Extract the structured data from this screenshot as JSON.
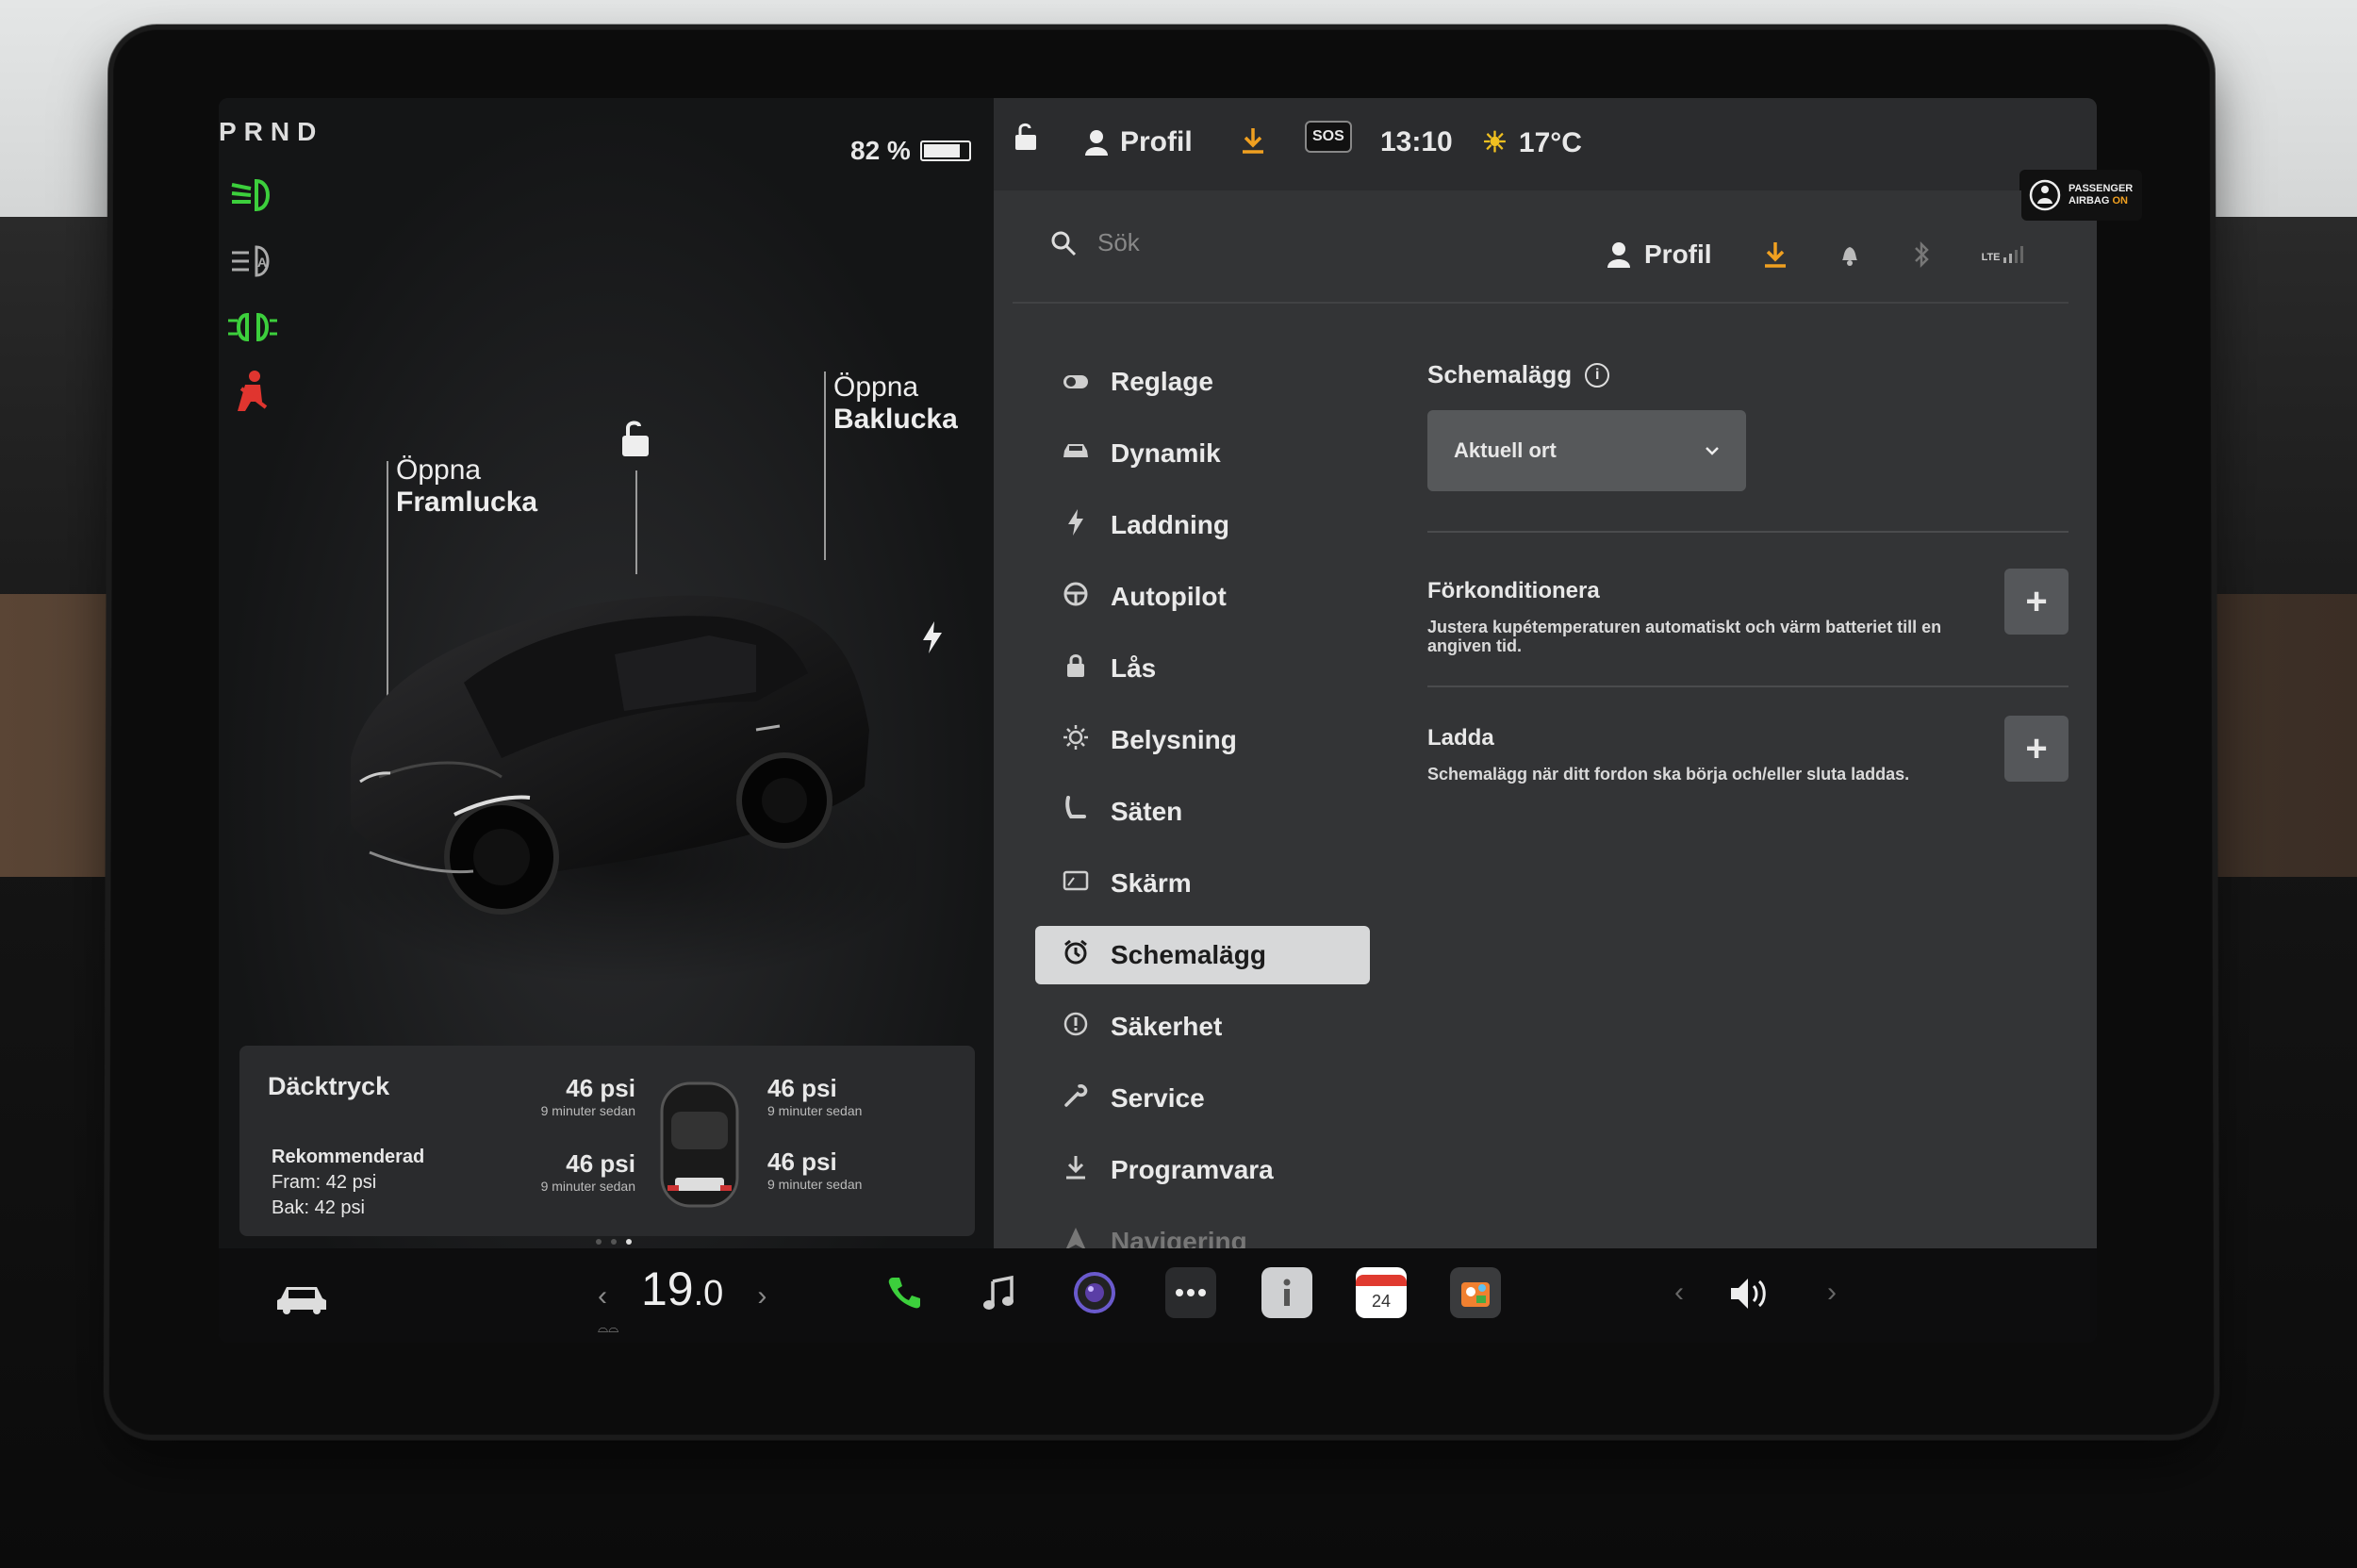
{
  "gear": "PRND",
  "battery": {
    "percent_label": "82 %",
    "level": 0.82
  },
  "vehicle": {
    "frunk": {
      "line1": "Öppna",
      "line2": "Framlucka"
    },
    "trunk": {
      "line1": "Öppna",
      "line2": "Baklucka"
    }
  },
  "tires": {
    "title": "Däcktryck",
    "recommended_label": "Rekommenderad",
    "front": "Fram: 42 psi",
    "rear": "Bak: 42 psi",
    "front_left": {
      "value": "46 psi",
      "age": "9 minuter sedan"
    },
    "front_right": {
      "value": "46 psi",
      "age": "9 minuter sedan"
    },
    "rear_left": {
      "value": "46 psi",
      "age": "9 minuter sedan"
    },
    "rear_right": {
      "value": "46 psi",
      "age": "9 minuter sedan"
    }
  },
  "statusbar": {
    "profile": "Profil",
    "sos": "SOS",
    "time": "13:10",
    "temperature": "17°C",
    "airbag_line1": "PASSENGER",
    "airbag_line2_prefix": "AIRBAG",
    "airbag_line2_state": "ON"
  },
  "settings": {
    "search_placeholder": "Sök",
    "profile": "Profil",
    "lte": "LTE",
    "menu": [
      {
        "label": "Reglage",
        "icon": "toggle-icon"
      },
      {
        "label": "Dynamik",
        "icon": "car-icon"
      },
      {
        "label": "Laddning",
        "icon": "bolt-icon"
      },
      {
        "label": "Autopilot",
        "icon": "steering-wheel-icon"
      },
      {
        "label": "Lås",
        "icon": "lock-icon"
      },
      {
        "label": "Belysning",
        "icon": "sun-icon"
      },
      {
        "label": "Säten",
        "icon": "seat-icon"
      },
      {
        "label": "Skärm",
        "icon": "display-icon"
      },
      {
        "label": "Schemalägg",
        "icon": "alarm-clock-icon",
        "active": true
      },
      {
        "label": "Säkerhet",
        "icon": "alert-icon"
      },
      {
        "label": "Service",
        "icon": "wrench-icon"
      },
      {
        "label": "Programvara",
        "icon": "download-icon"
      },
      {
        "label": "Navigering",
        "icon": "navigation-icon"
      }
    ],
    "schedule": {
      "title": "Schemalägg",
      "location_value": "Aktuell ort",
      "precondition_title": "Förkonditionera",
      "precondition_desc": "Justera kupétemperaturen automatiskt och värm batteriet till en angiven tid.",
      "charge_title": "Ladda",
      "charge_desc": "Schemalägg när ditt fordon ska börja och/eller sluta laddas."
    }
  },
  "dock": {
    "cabin_temp_int": "19",
    "cabin_temp_dec": ".0",
    "calendar_day": "24"
  },
  "colors": {
    "indicator_green": "#3ccf3c",
    "indicator_red": "#e0352f",
    "accent_orange": "#f0a020",
    "active_menu_bg": "#d7d8d9"
  }
}
